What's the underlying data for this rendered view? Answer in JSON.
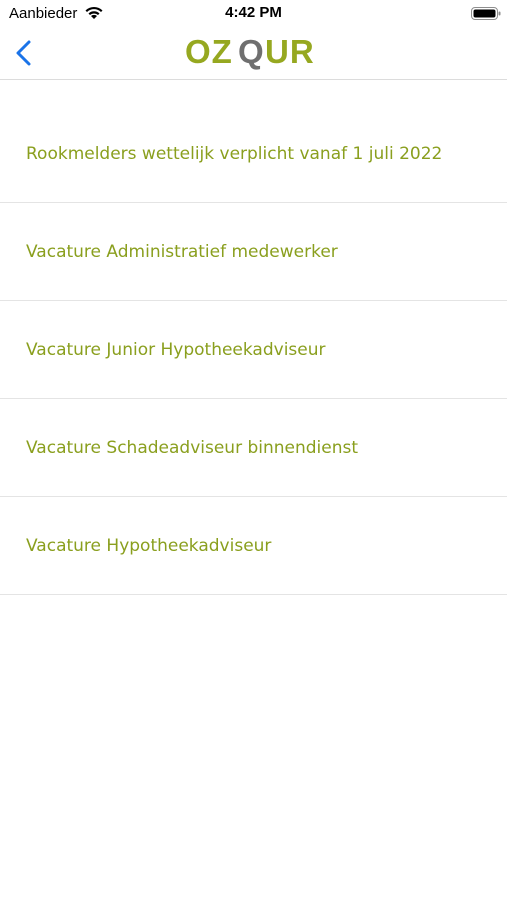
{
  "status_bar": {
    "carrier": "Aanbieder",
    "time": "4:42 PM"
  },
  "nav_bar": {
    "logo": {
      "text_left": "OZ",
      "text_mid": "Q",
      "text_right": "UR",
      "accent_color": "#96a820",
      "mid_color": "#6f6f6f"
    }
  },
  "news_list": {
    "items": [
      {
        "title": "Rookmelders wettelijk verplicht vanaf 1 juli 2022"
      },
      {
        "title": "Vacature Administratief medewerker"
      },
      {
        "title": "Vacature Junior Hypotheekadviseur"
      },
      {
        "title": "Vacature Schadeadviseur binnendienst"
      },
      {
        "title": "Vacature Hypotheekadviseur"
      }
    ],
    "text_color": "#8a9f1e"
  },
  "colors": {
    "back_button": "#1a73e8",
    "separator": "#e4e4e4"
  }
}
